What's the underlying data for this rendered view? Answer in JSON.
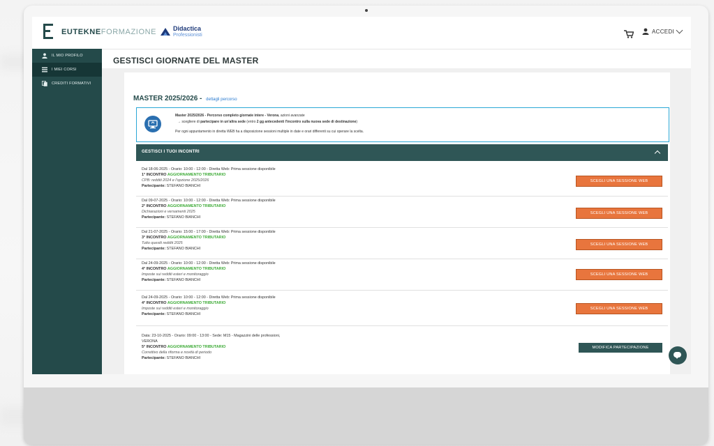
{
  "header": {
    "brand_bold": "EUTEKNE",
    "brand_light": "FORMAZIONE",
    "partner_line1": "Didactica",
    "partner_line2": "Professionisti",
    "login_label": "ACCEDI"
  },
  "sidebar": {
    "items": [
      {
        "label": "IL MIO PROFILO",
        "icon": "user-icon",
        "active": false
      },
      {
        "label": "I MIEI CORSI",
        "icon": "list-icon",
        "active": true
      },
      {
        "label": "CREDITI FORMATIVI",
        "icon": "copy-icon",
        "active": false
      }
    ]
  },
  "page": {
    "title": "GESTISCI GIORNATE DEL MASTER",
    "master_title": "MASTER 2025/2026",
    "master_sep": " - ",
    "master_link": "dettagli percorso"
  },
  "info": {
    "l1_bold": "Master 2025/2026 - Percorso completo giornate intere - Verona",
    "l1_rest": ", azioni avanzate",
    "l2_pre": "→ scegliere di ",
    "l2_bold": "partecipare in un'altra sede",
    "l2_mid": " (entro ",
    "l2_bold2": "2 gg antecedenti l'incontro sulla nuova sede di destinazione",
    "l2_end": ")",
    "l3": "Per ogni appuntamento in diretta WEB ha a disposizione sessioni multiple in date e orari differenti su cui operare la scelta."
  },
  "section": {
    "title": "GESTISCI I TUOI INCONTRI"
  },
  "events": [
    {
      "line1": "Dal 18-06-2025 - Orario: 10:00 - 12:00 - Diretta Web: Prima sessione disponibile",
      "num": "1° INCONTRO",
      "topic": "AGGIORNAMENTO TRIBUTARIO",
      "desc": "CPB: redditi 2024 e l'opzione 2025/2026",
      "participant_label": "Partecipante:",
      "participant": "STEFANO BIANCHI",
      "button": "SCEGLI UNA SESSIONE WEB"
    },
    {
      "line1": "Dal 09-07-2025 - Orario: 10:00 - 12:00 - Diretta Web: Prima sessione disponibile",
      "num": "2° INCONTRO",
      "topic": "AGGIORNAMENTO TRIBUTARIO",
      "desc": "Dichiarazioni e versamenti 2025",
      "participant_label": "Partecipante:",
      "participant": "STEFANO BIANCHI",
      "button": "SCEGLI UNA SESSIONE WEB"
    },
    {
      "line1": "Dal 21-07-2025 - Orario: 15:00 - 17:00 - Diretta Web: Prima sessione disponibile",
      "num": "3° INCONTRO",
      "topic": "AGGIORNAMENTO TRIBUTARIO",
      "desc": "Tutto quesiti redditi 2025",
      "participant_label": "Partecipante:",
      "participant": "STEFANO BIANCHI",
      "button": "SCEGLI UNA SESSIONE WEB"
    },
    {
      "line1": "Dal 24-09-2025 - Orario: 10:00 - 12:00 - Diretta Web: Prima sessione disponibile",
      "num": "4° INCONTRO",
      "topic": "AGGIORNAMENTO TRIBUTARIO",
      "desc": "Imposte sui redditi esteri e monitoraggio",
      "participant_label": "Partecipante:",
      "participant": "STEFANO BIANCHI",
      "button": "SCEGLI UNA SESSIONE WEB"
    },
    {
      "line1": "Dal 24-09-2025 - Orario: 10:00 - 12:00 - Diretta Web: Prima sessione disponibile",
      "num": "4° INCONTRO",
      "topic": "AGGIORNAMENTO TRIBUTARIO",
      "desc": "Imposte sui redditi esteri e monitoraggio",
      "participant_label": "Partecipante:",
      "participant": "STEFANO BIANCHI",
      "button": "SCEGLI UNA SESSIONE WEB"
    }
  ],
  "event_last": {
    "line1": "Data: 23-10-2025 - Orario: 09:00 - 13:00 - Sede: M15 - Magazzini delle professioni,",
    "line1b": "VERONA",
    "num": "5° INCONTRO",
    "topic": "AGGIORNAMENTO TRIBUTARIO",
    "desc": "Correttivo della riforma e novità di periodo",
    "participant_label": "Partecipante:",
    "participant": "STEFANO BIANCHI",
    "button": "MODIFICA PARTECIPAZIONE"
  },
  "colors": {
    "teal_dark": "#244a4a",
    "teal": "#2f5656",
    "orange": "#e8753d",
    "green": "#3caa35",
    "info_border": "#2aa7d6"
  }
}
